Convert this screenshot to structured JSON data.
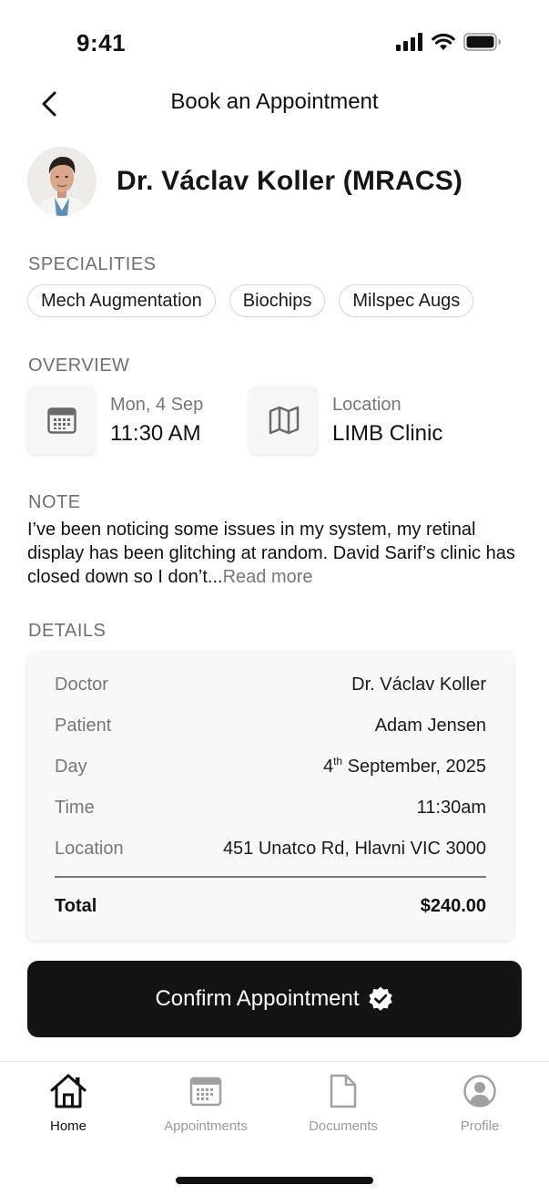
{
  "status": {
    "time": "9:41"
  },
  "nav": {
    "title": "Book an Appointment"
  },
  "doctor": {
    "name": "Dr. Václav Koller (MRACS)"
  },
  "specialities": {
    "label": "SPECIALITIES",
    "items": [
      "Mech Augmentation",
      "Biochips",
      "Milspec Augs"
    ]
  },
  "overview": {
    "label": "OVERVIEW",
    "date": {
      "sub": "Mon, 4 Sep",
      "main": "11:30 AM",
      "icon": "calendar-icon"
    },
    "location": {
      "sub": "Location",
      "main": "LIMB Clinic",
      "icon": "map-icon"
    }
  },
  "note": {
    "label": "NOTE",
    "text": "I’ve been noticing some issues in my system, my retinal display has been glitching at random. David Sarif’s clinic has closed down so I don’t...",
    "read_more": "Read more"
  },
  "details": {
    "label": "DETAILS",
    "doctor_key": "Doctor",
    "doctor_val": "Dr. Václav Koller",
    "patient_key": "Patient",
    "patient_val": "Adam Jensen",
    "day_key": "Day",
    "day_num": "4",
    "day_sup": "th",
    "day_rest": " September, 2025",
    "time_key": "Time",
    "time_val": "11:30am",
    "location_key": "Location",
    "location_val": "451 Unatco Rd, Hlavni VIC 3000",
    "total_key": "Total",
    "total_val": "$240.00"
  },
  "confirm": {
    "label": "Confirm Appointment",
    "icon": "verified-badge-icon"
  },
  "tabs": [
    {
      "label": "Home",
      "icon": "home-icon",
      "active": true
    },
    {
      "label": "Appointments",
      "icon": "calendar-icon",
      "active": false
    },
    {
      "label": "Documents",
      "icon": "document-icon",
      "active": false
    },
    {
      "label": "Profile",
      "icon": "profile-icon",
      "active": false
    }
  ]
}
